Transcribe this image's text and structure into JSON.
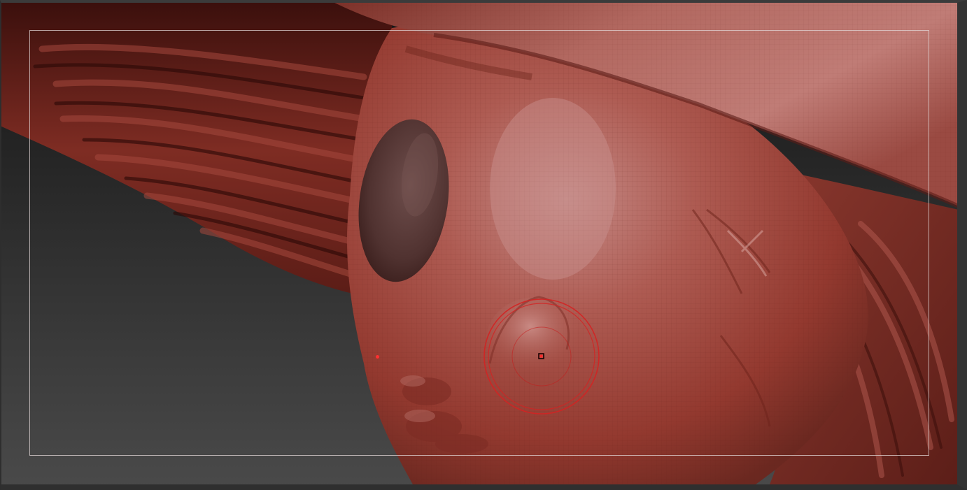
{
  "app": {
    "canvas_label": "",
    "tool": "sculpt-brush"
  },
  "colors": {
    "background_top": "#1a1a1a",
    "background_bottom": "#4a4a4a",
    "clay_base": "#a4473d",
    "clay_dark": "#6b2820",
    "clay_shadow": "#3d1512",
    "clay_highlight": "#c98a86",
    "eye_material": "#5a3a38",
    "brush_ring": "#d82020",
    "safe_frame": "#e0d6d6"
  },
  "icons": {
    "brush_cursor": "brush-cursor-icon",
    "pivot": "pivot-point-icon"
  }
}
